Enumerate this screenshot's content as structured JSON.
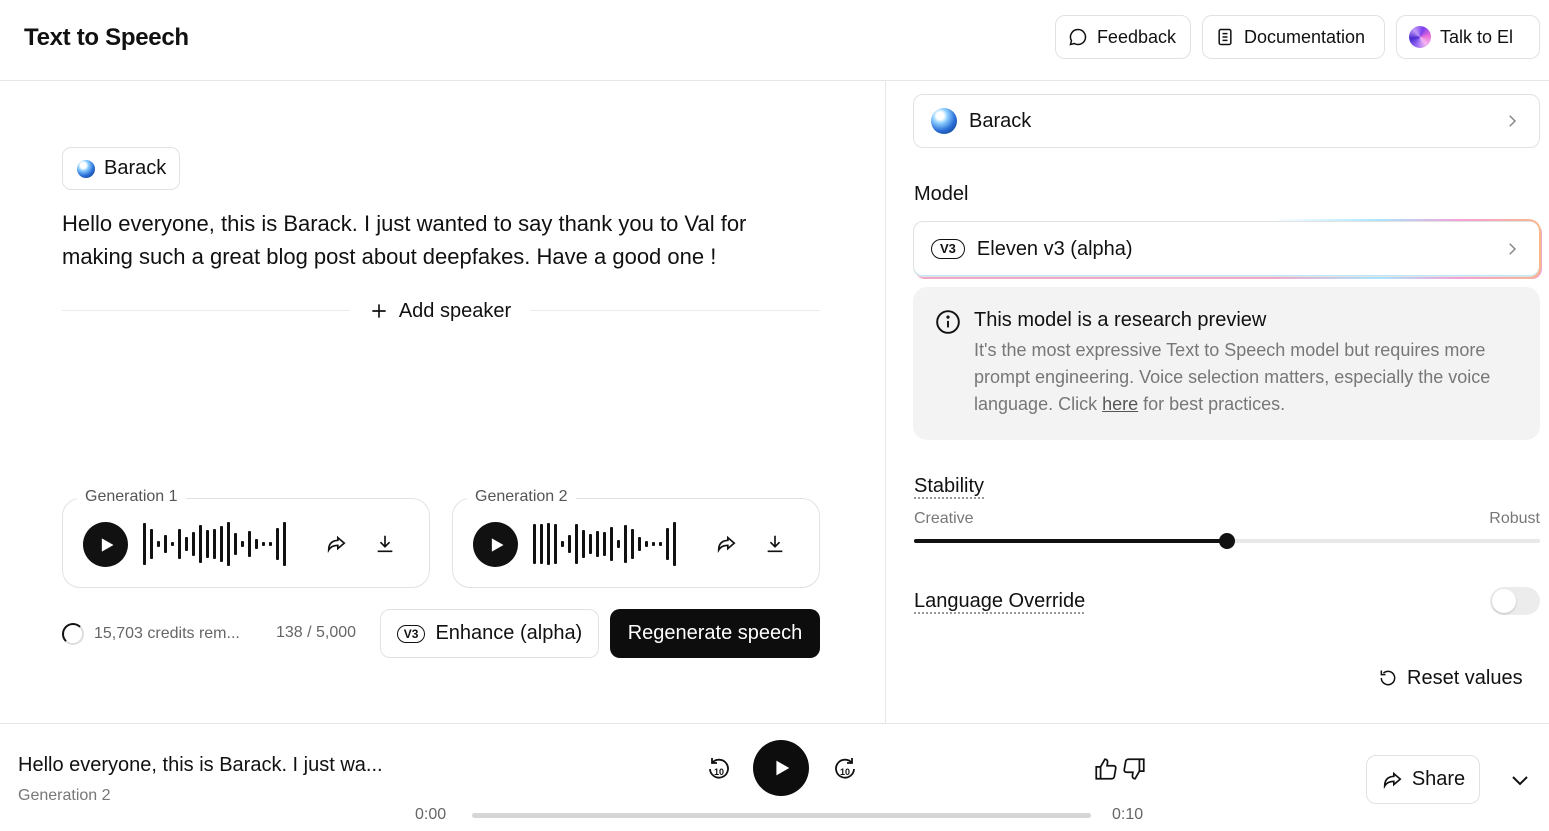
{
  "header": {
    "title": "Text to Speech",
    "feedback_label": "Feedback",
    "documentation_label": "Documentation",
    "talk_label": "Talk to El"
  },
  "editor": {
    "speaker_name": "Barack",
    "text": "Hello everyone, this is Barack. I just wanted to say thank you to Val for making such a great blog post about deepfakes. Have a good one !",
    "add_speaker_label": "Add speaker"
  },
  "generations": [
    {
      "label": "Generation 1"
    },
    {
      "label": "Generation 2"
    }
  ],
  "footer_controls": {
    "credits": "15,703 credits rem...",
    "char_count": "138 / 5,000",
    "enhance_badge": "V3",
    "enhance_label": "Enhance (alpha)",
    "regenerate_label": "Regenerate speech"
  },
  "settings": {
    "voice": "Barack",
    "model_label": "Model",
    "model_badge": "V3",
    "model_name": "Eleven v3 (alpha)",
    "info_title": "This model is a research preview",
    "info_body_prefix": "It's the most expressive Text to Speech model but requires more prompt engineering. Voice selection matters, especially the voice language. Click ",
    "info_link": "here",
    "info_body_suffix": " for best practices.",
    "stability_label": "Stability",
    "stability_min": "Creative",
    "stability_max": "Robust",
    "stability_value": 0.5,
    "language_override_label": "Language Override",
    "language_override_on": false,
    "reset_label": "Reset values"
  },
  "player": {
    "title": "Hello everyone, this is Barack. I just wa...",
    "subtitle": "Generation 2",
    "skip_back": "10",
    "skip_forward": "10",
    "current_time": "0:00",
    "duration": "0:10",
    "progress": 0,
    "share_label": "Share"
  },
  "colors": {
    "primary": "#0d0d0d",
    "border": "#e2e2e2",
    "info_bg": "#f3f3f3"
  }
}
